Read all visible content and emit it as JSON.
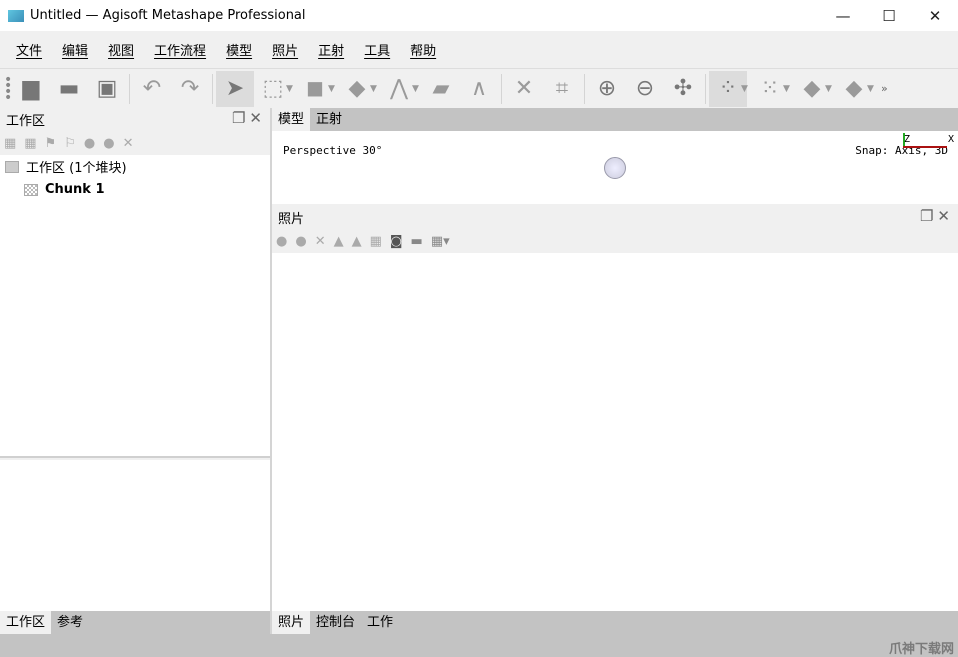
{
  "window": {
    "title": "Untitled — Agisoft Metashape Professional",
    "minimize": "—",
    "maximize": "☐",
    "close": "✕"
  },
  "menu": [
    "文件",
    "编辑",
    "视图",
    "工作流程",
    "模型",
    "照片",
    "正射",
    "工具",
    "帮助"
  ],
  "workspace": {
    "title": "工作区",
    "root": "工作区 (1个堆块)",
    "chunk": "Chunk 1",
    "tabs": [
      "工作区",
      "参考"
    ]
  },
  "model": {
    "tabs": [
      "模型",
      "正射"
    ],
    "perspective": "Perspective 30°",
    "snap": "Snap: Axis, 3D",
    "axis_z": "Z",
    "axis_x": "X"
  },
  "photos": {
    "title": "照片",
    "tabs": [
      "照片",
      "控制台",
      "工作"
    ]
  },
  "watermark": "爪神下载网",
  "colors": {
    "accent_x": "#aa1111",
    "accent_z": "#22aa22"
  }
}
